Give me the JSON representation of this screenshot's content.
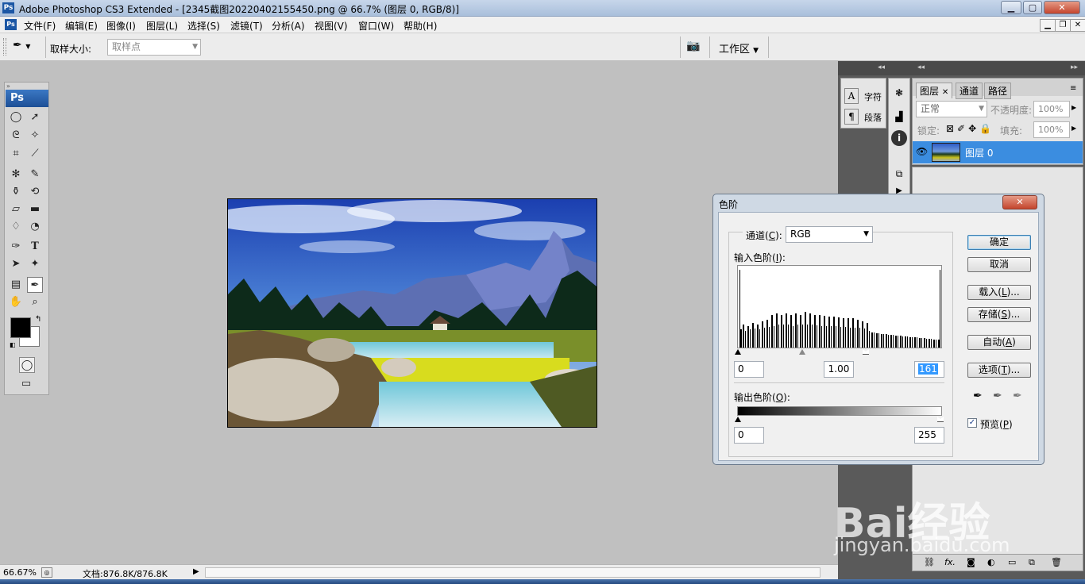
{
  "window": {
    "title": "Adobe Photoshop CS3 Extended - [2345截图20220402155450.png @ 66.7% (图层 0, RGB/8)]",
    "logo": "Ps",
    "minimize": "▁",
    "maximize": "▢",
    "close": "✕"
  },
  "menu": {
    "items": [
      "文件(F)",
      "编辑(E)",
      "图像(I)",
      "图层(L)",
      "选择(S)",
      "滤镜(T)",
      "分析(A)",
      "视图(V)",
      "窗口(W)",
      "帮助(H)"
    ]
  },
  "options_bar": {
    "sample_size_label": "取样大小:",
    "sample_size_value": "取样点",
    "workspace_label": "工作区"
  },
  "toolbox": {
    "logo": "Ps",
    "text_tool": "T"
  },
  "status_bar": {
    "zoom": "66.67%",
    "doc_info": "文档:876.8K/876.8K"
  },
  "panels": {
    "char_label": "字符",
    "para_label": "段落",
    "layers_tab": "图层",
    "channels_tab": "通道",
    "paths_tab": "路径",
    "blend_mode": "正常",
    "opacity_label": "不透明度:",
    "opacity_value": "100%",
    "lock_label": "锁定:",
    "fill_label": "填充:",
    "fill_value": "100%",
    "layer_name": "图层 0"
  },
  "levels_dialog": {
    "title": "色阶",
    "channel_label": "通道(",
    "channel_key": "C",
    "channel_suffix": "):",
    "channel_value": "RGB",
    "input_label": "输入色阶(",
    "input_key": "I",
    "input_suffix": "):",
    "input_black": "0",
    "input_gamma": "1.00",
    "input_white": "161",
    "output_label": "输出色阶(",
    "output_key": "O",
    "output_suffix": "):",
    "output_black": "0",
    "output_white": "255",
    "ok": "确定",
    "cancel": "取消",
    "load": "载入(",
    "load_key": "L",
    "load_suffix": ")...",
    "save": "存储(",
    "save_key": "S",
    "save_suffix": ")...",
    "auto": "自动(",
    "auto_key": "A",
    "auto_suffix": ")",
    "options": "选项(",
    "options_key": "T",
    "options_suffix": ")...",
    "preview": "预览(",
    "preview_key": "P",
    "preview_suffix": ")",
    "preview_checked": true
  },
  "watermark": {
    "brand": "Bai经验",
    "url": "jingyan.baidu.com"
  }
}
